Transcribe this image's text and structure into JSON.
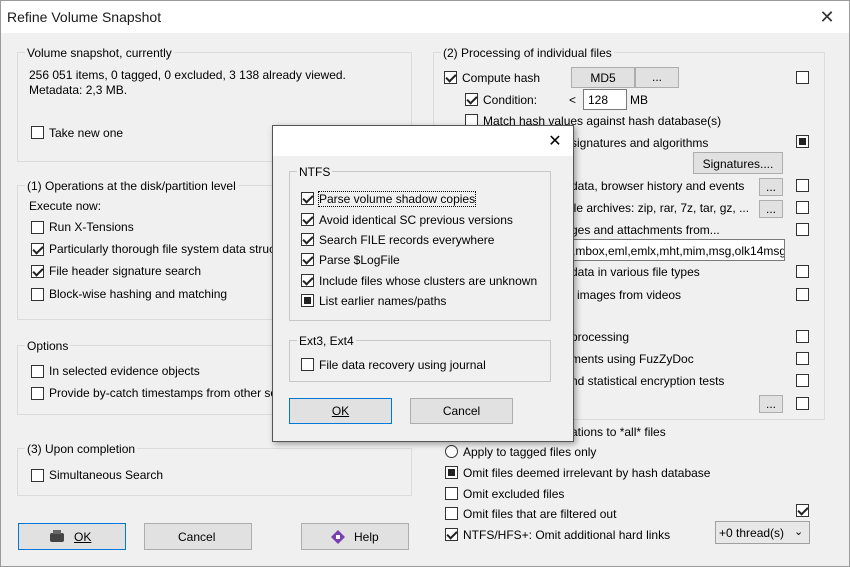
{
  "window": {
    "title": "Refine Volume Snapshot",
    "close_glyph": "✕"
  },
  "snapshot": {
    "group_label": "Volume snapshot, currently",
    "stats_line1": "256 051 items, 0 tagged, 0 excluded, 3 138 already viewed.",
    "stats_line2": "Metadata: 2,3 MB.",
    "take_new_one": "Take new one"
  },
  "disk_ops": {
    "group_label": "(1) Operations at the disk/partition level",
    "execute_now": "Execute now:",
    "items": [
      {
        "label": "Run X-Tensions",
        "checked": false
      },
      {
        "label": "Particularly thorough file system data struc",
        "checked": true
      },
      {
        "label": "File header signature search",
        "checked": true
      },
      {
        "label": "Block-wise hashing and matching",
        "checked": false
      }
    ]
  },
  "options": {
    "group_label": "Options",
    "items": [
      {
        "label": "In selected evidence objects",
        "checked": false
      },
      {
        "label": "Provide by-catch timestamps from other so",
        "checked": false
      }
    ]
  },
  "completion": {
    "group_label": "(3) Upon completion",
    "simultaneous": "Simultaneous Search"
  },
  "bottom_buttons": {
    "ok": "OK",
    "cancel": "Cancel",
    "help": "Help"
  },
  "processing": {
    "group_label": "(2) Processing of individual files",
    "compute_hash": "Compute hash",
    "hash_type": "MD5",
    "more": "...",
    "condition": "Condition:",
    "lt": "<",
    "size_value": "128",
    "size_unit": "MB",
    "match_hash": "Match hash values against hash database(s)",
    "sig_algos": "signatures and algorithms",
    "signatures_btn": "Signatures....",
    "browser_history": "data, browser history and events",
    "archives": "ile archives: zip, rar, 7z, tar, gz, ...",
    "attachments": "ges and attachments from...",
    "email_formats": ",mbox,eml,emlx,mht,mim,msg,olk14msgs",
    "various_types": "data in various file types",
    "videos": "l images from videos",
    "processing_lbl": "processing",
    "fuzzydoc": "ments using FuzZyDoc",
    "encryption": "nd statistical encryption tests",
    "all_files": "ations to *all* files",
    "apply_tagged": "Apply to tagged files only",
    "omit_irrelevant": "Omit files deemed irrelevant by hash database",
    "omit_excluded": "Omit excluded files",
    "omit_filtered": "Omit files that are filtered out",
    "omit_hardlinks": "NTFS/HFS+: Omit additional hard links",
    "threads": "+0 thread(s)"
  },
  "ntfs_dialog": {
    "close_glyph": "✕",
    "ntfs_label": "NTFS",
    "ntfs_items": [
      {
        "label": "Parse volume shadow copies",
        "state": "checked"
      },
      {
        "label": "Avoid identical SC previous versions",
        "state": "checked"
      },
      {
        "label": "Search FILE records everywhere",
        "state": "checked"
      },
      {
        "label": "Parse $LogFile",
        "state": "checked"
      },
      {
        "label": "Include files whose clusters are unknown",
        "state": "checked"
      },
      {
        "label": "List earlier names/paths",
        "state": "indeterminate"
      }
    ],
    "ext_label": "Ext3, Ext4",
    "ext_item": "File data recovery using journal",
    "ok": "OK",
    "cancel": "Cancel"
  }
}
